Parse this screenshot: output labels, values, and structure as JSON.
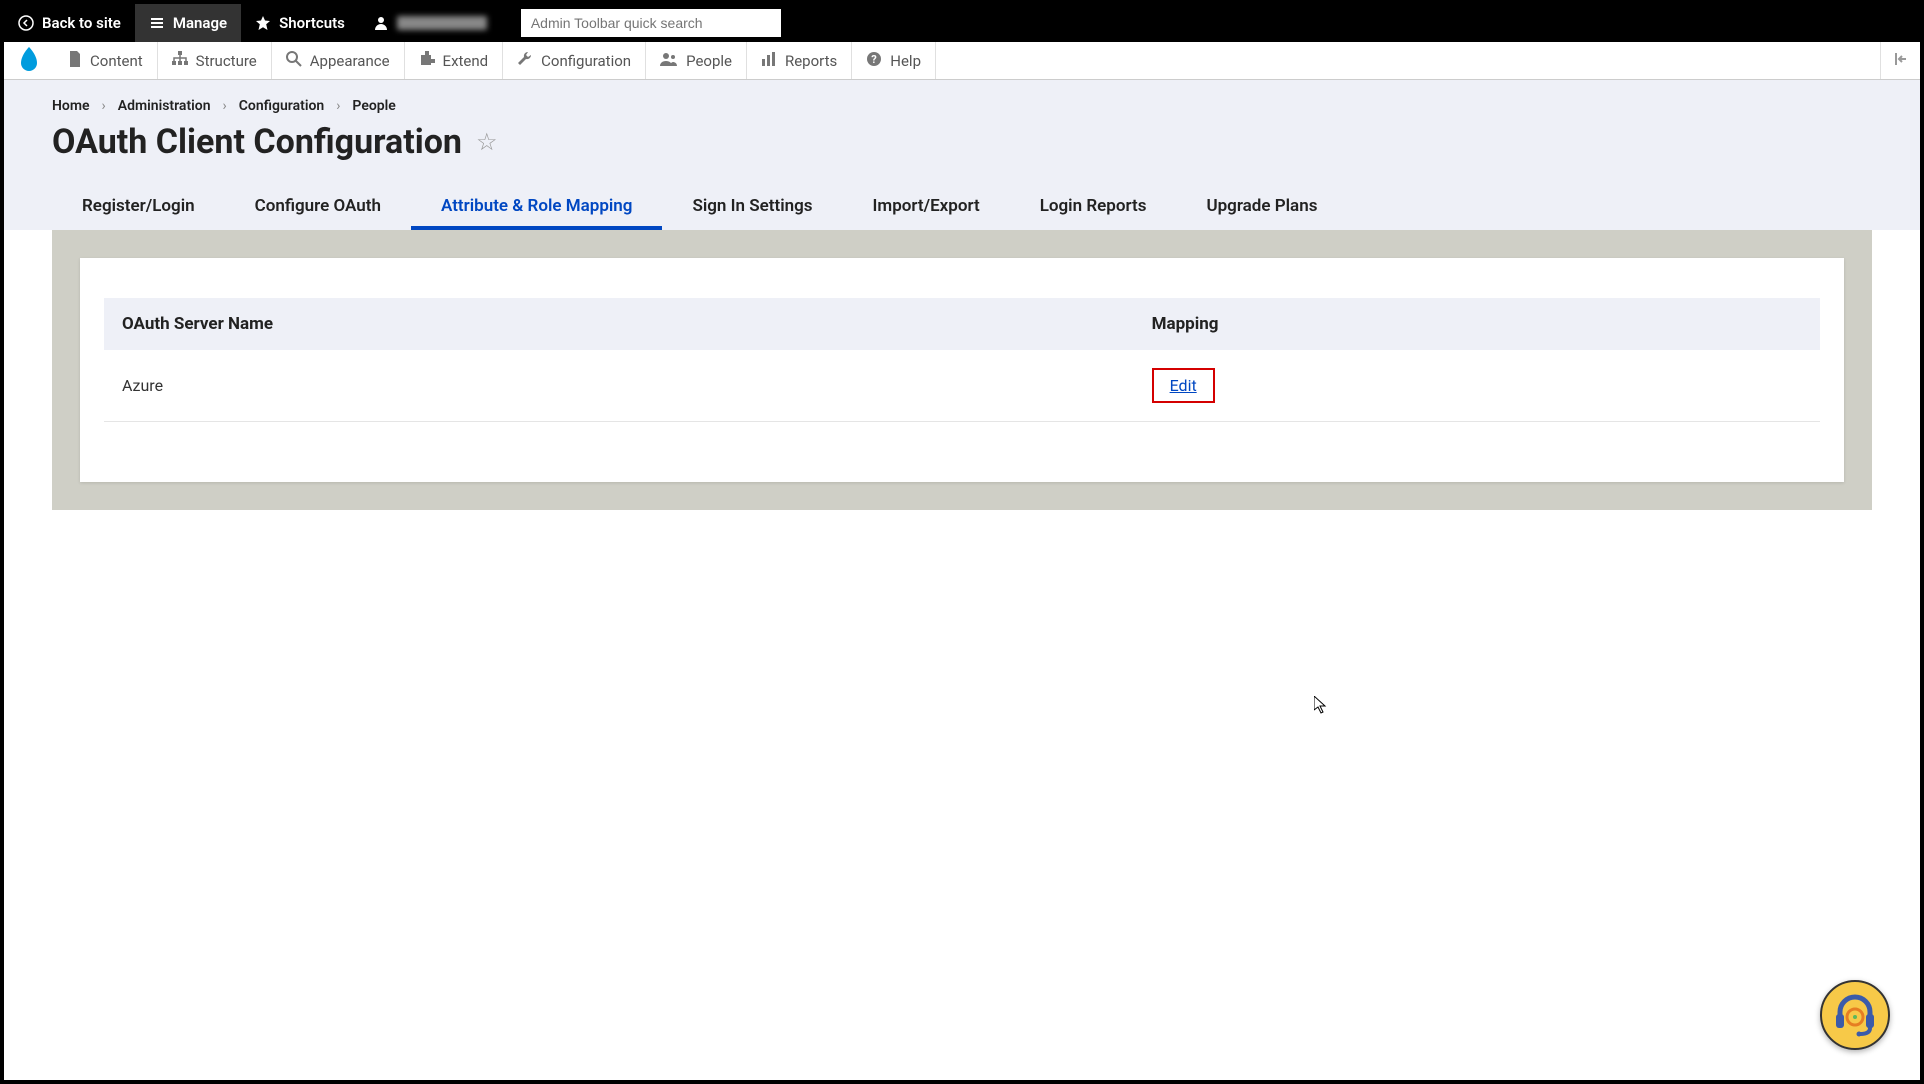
{
  "toolbar_top": {
    "back_to_site": "Back to site",
    "manage": "Manage",
    "shortcuts": "Shortcuts",
    "search_placeholder": "Admin Toolbar quick search"
  },
  "toolbar_admin": {
    "content": "Content",
    "structure": "Structure",
    "appearance": "Appearance",
    "extend": "Extend",
    "configuration": "Configuration",
    "people": "People",
    "reports": "Reports",
    "help": "Help"
  },
  "breadcrumb": {
    "home": "Home",
    "administration": "Administration",
    "configuration": "Configuration",
    "people": "People"
  },
  "page_title": "OAuth Client Configuration",
  "tabs": {
    "register_login": "Register/Login",
    "configure_oauth": "Configure OAuth",
    "attribute_role_mapping": "Attribute & Role Mapping",
    "sign_in_settings": "Sign In Settings",
    "import_export": "Import/Export",
    "login_reports": "Login Reports",
    "upgrade_plans": "Upgrade Plans"
  },
  "table": {
    "col_server": "OAuth Server Name",
    "col_mapping": "Mapping",
    "rows": [
      {
        "server": "Azure",
        "action": "Edit"
      }
    ]
  }
}
